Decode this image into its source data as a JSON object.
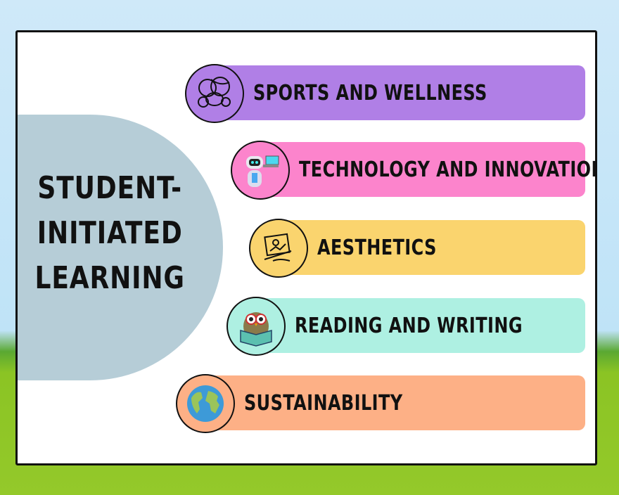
{
  "title_lines": [
    "STUDENT-",
    "INITIATED",
    "LEARNING"
  ],
  "items": [
    {
      "label": "SPORTS AND WELLNESS",
      "icon": "sports-balls-icon",
      "color": "#b07fe6"
    },
    {
      "label": "TECHNOLOGY AND INNOVATION",
      "icon": "robot-laptop-icon",
      "color": "#fc84cc"
    },
    {
      "label": "AESTHETICS",
      "icon": "art-supplies-icon",
      "color": "#fad46e"
    },
    {
      "label": "READING AND WRITING",
      "icon": "owl-reading-icon",
      "color": "#aef0e2"
    },
    {
      "label": "SUSTAINABILITY",
      "icon": "globe-icon",
      "color": "#fdb086"
    }
  ]
}
